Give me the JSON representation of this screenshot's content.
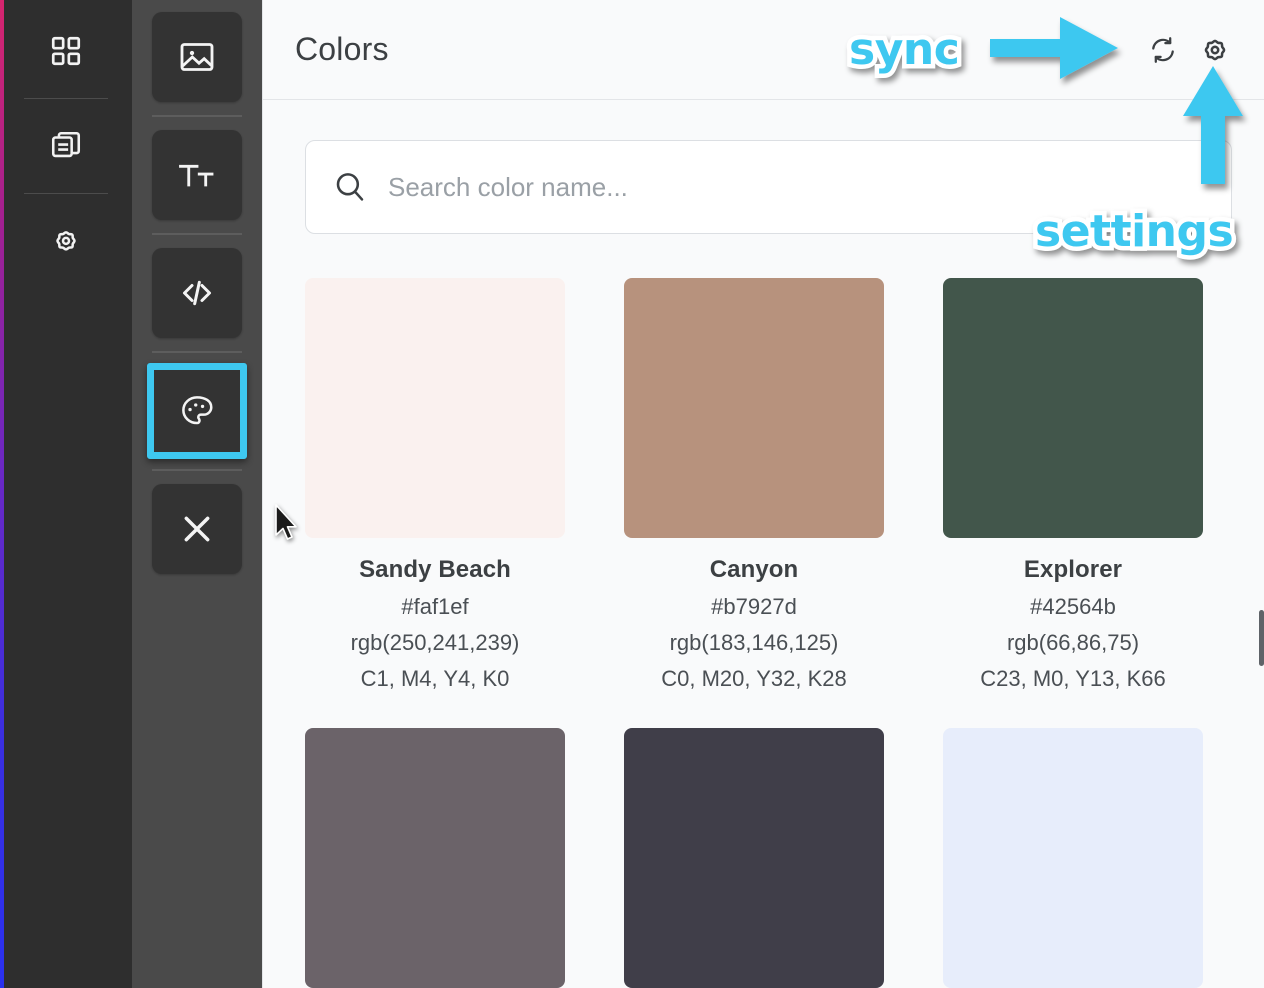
{
  "window": {
    "edge_gradient_from": "#d6256e",
    "edge_gradient_to": "#2a31ef"
  },
  "primary_rail": {
    "background": "#2e2e2e",
    "items": [
      {
        "name": "dashboard",
        "icon": "grid-icon"
      },
      {
        "name": "layers",
        "icon": "copy-layers-icon"
      },
      {
        "name": "settings",
        "icon": "gear-icon"
      }
    ]
  },
  "tool_rail": {
    "background": "#4a4a4a",
    "selected_index": 3,
    "selection_color": "#3ec8f0",
    "items": [
      {
        "name": "images",
        "icon": "image-icon"
      },
      {
        "name": "typography",
        "icon": "text-size-icon"
      },
      {
        "name": "code",
        "icon": "code-icon"
      },
      {
        "name": "colors",
        "icon": "palette-icon"
      },
      {
        "name": "close",
        "icon": "close-icon"
      }
    ]
  },
  "header": {
    "title": "Colors",
    "actions": [
      {
        "name": "sync",
        "icon": "sync-icon"
      },
      {
        "name": "settings",
        "icon": "gear-icon"
      }
    ]
  },
  "search": {
    "placeholder": "Search color name...",
    "value": "",
    "icon": "search-icon"
  },
  "annotations": [
    {
      "id": "sync",
      "label": "sync",
      "color": "#3ec8f0",
      "target": "sync-icon"
    },
    {
      "id": "settings",
      "label": "settings",
      "color": "#3ec8f0",
      "target": "settings-icon"
    }
  ],
  "colors": [
    {
      "name": "Sandy Beach",
      "hex": "#faf1ef",
      "rgb": "rgb(250,241,239)",
      "cmyk": "C1, M4, Y4, K0"
    },
    {
      "name": "Canyon",
      "hex": "#b7927d",
      "rgb": "rgb(183,146,125)",
      "cmyk": "C0, M20, Y32, K28"
    },
    {
      "name": "Explorer",
      "hex": "#42564b",
      "rgb": "rgb(66,86,75)",
      "cmyk": "C23, M0, Y13, K66"
    },
    {
      "name": "",
      "hex": "#6b6369",
      "rgb": "",
      "cmyk": ""
    },
    {
      "name": "",
      "hex": "#403e49",
      "rgb": "",
      "cmyk": ""
    },
    {
      "name": "",
      "hex": "#e7edfb",
      "rgb": "",
      "cmyk": ""
    }
  ]
}
